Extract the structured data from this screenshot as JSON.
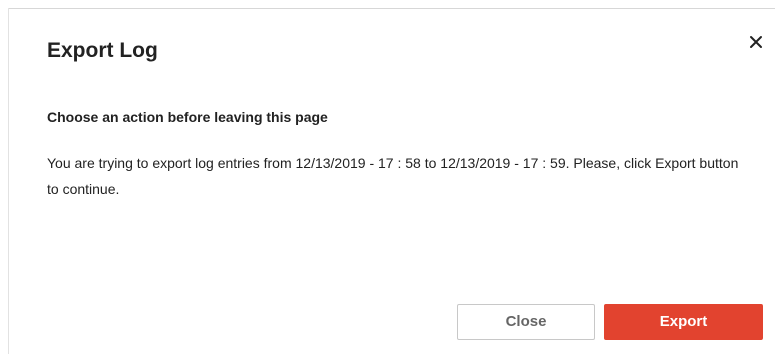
{
  "dialog": {
    "title": "Export Log",
    "close_icon": "close-icon",
    "subheading": "Choose an action before leaving this page",
    "message": "You are trying to export log entries from 12/13/2019 - 17 : 58 to 12/13/2019 - 17 : 59. Please, click Export button to continue.",
    "buttons": {
      "close_label": "Close",
      "export_label": "Export"
    }
  },
  "colors": {
    "primary_button": "#e2432f",
    "secondary_button_border": "#c8c8c8",
    "text": "#222222"
  }
}
